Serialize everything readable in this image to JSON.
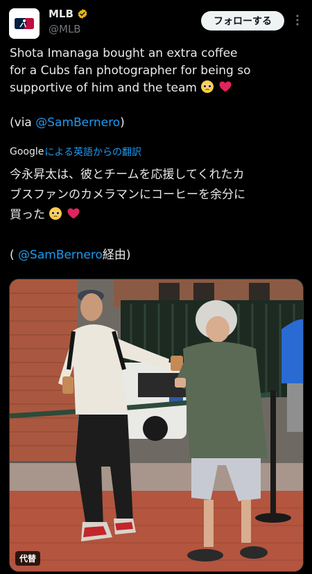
{
  "account": {
    "name": "MLB",
    "handle": "@MLB",
    "follow_label": "フォローする"
  },
  "tweet": {
    "line1": "Shota Imanaga bought an extra coffee",
    "line2": "for a Cubs fan photographer for being so",
    "line3": "supportive of him and the team",
    "via_prefix": "(via ",
    "via_handle": "@SamBernero",
    "via_suffix": ")"
  },
  "translation": {
    "google": "Google",
    "label": "による英語からの翻訳",
    "jp_line1": "今永昇太は、彼とチームを応援してくれたカ",
    "jp_line2": "ブスファンのカメラマンにコーヒーを余分に",
    "jp_line3": "買った",
    "jp_via_prefix": "( ",
    "jp_via_handle": "@SamBernero",
    "jp_via_suffix": "経由)"
  },
  "media": {
    "alt_badge": "代替"
  },
  "colors": {
    "background": "#000000",
    "text": "#e7e9ea",
    "secondary": "#71767b",
    "link": "#1d9bf0",
    "verified_gold": "#e2b719"
  },
  "icons": [
    "mlb-logo-icon",
    "verified-badge-icon",
    "more-options-icon",
    "pleading-face-emoji",
    "red-heart-emoji"
  ]
}
